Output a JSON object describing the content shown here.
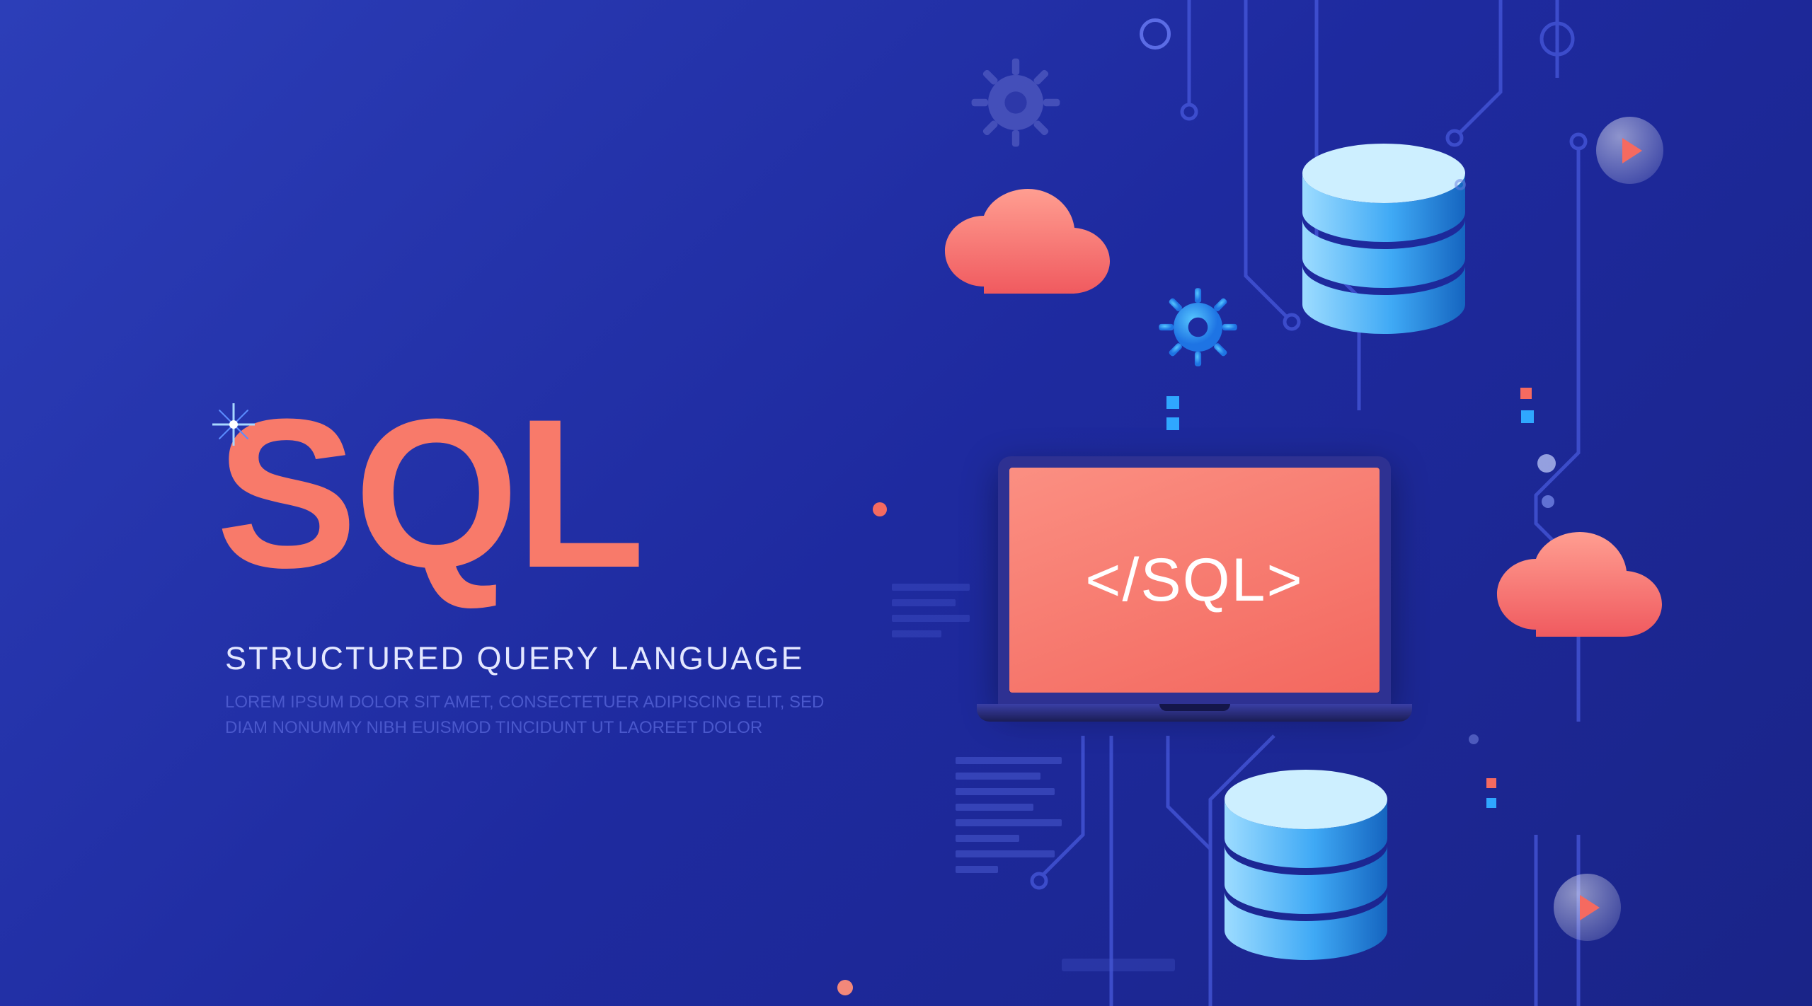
{
  "headline": {
    "title": "SQL",
    "subtitle": "STRUCTURED QUERY LANGUAGE",
    "lorem": "LOREM IPSUM DOLOR SIT AMET, CONSECTETUER ADIPISCING ELIT, SED\nDIAM NONUMMY NIBH EUISMOD TINCIDUNT UT LAOREET DOLOR"
  },
  "laptop": {
    "screen_text": "</SQL>"
  },
  "colors": {
    "accent_pink": "#f87a6a",
    "accent_blue": "#3fb4f7",
    "bg_start": "#2c3eb8",
    "bg_end": "#1a2488"
  },
  "icons": [
    "cloud-icon",
    "database-icon",
    "gear-icon",
    "play-icon",
    "sparkle-icon",
    "circuit-trace-icon",
    "document-lines-icon"
  ]
}
